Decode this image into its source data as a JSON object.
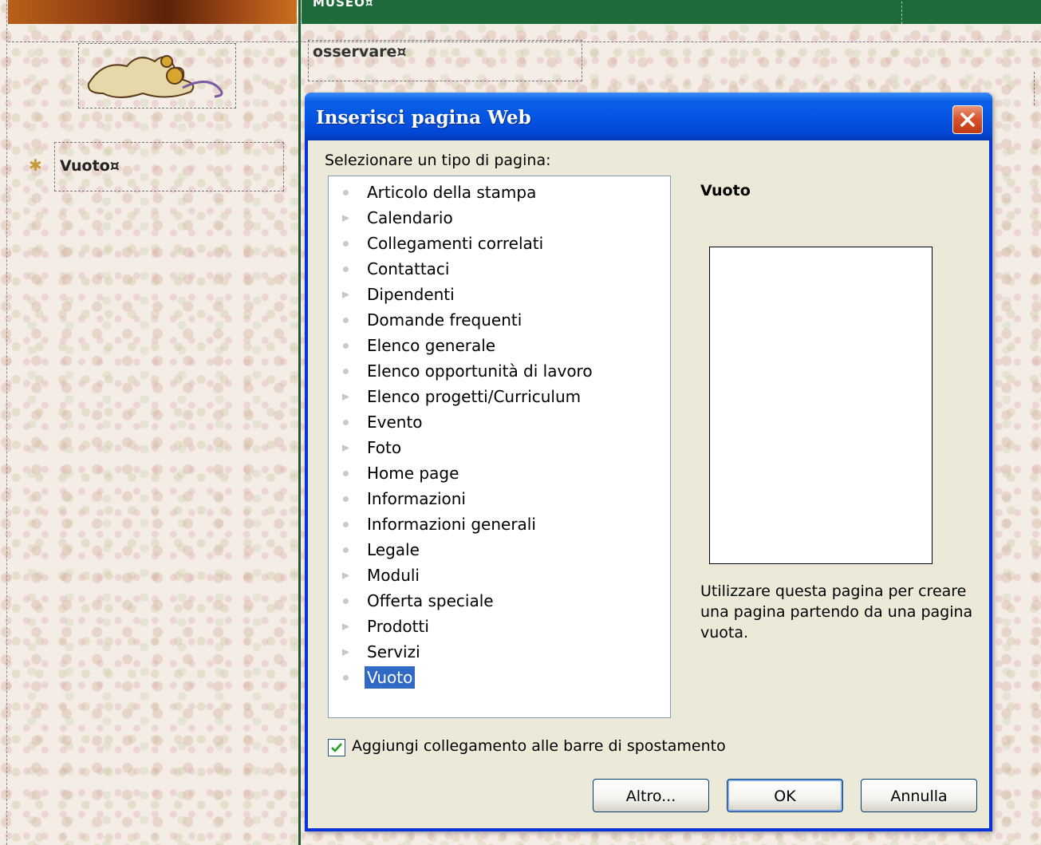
{
  "background": {
    "nav_label": "MUSEO¤",
    "sidebar_item": "Vuoto¤",
    "content_text": "osservare¤"
  },
  "dialog": {
    "title": "Inserisci pagina Web",
    "prompt": "Selezionare un tipo di pagina:",
    "items": [
      {
        "label": "Articolo della stampa",
        "icon": "dot"
      },
      {
        "label": "Calendario",
        "icon": "arrow"
      },
      {
        "label": "Collegamenti correlati",
        "icon": "dot"
      },
      {
        "label": "Contattaci",
        "icon": "dot"
      },
      {
        "label": "Dipendenti",
        "icon": "arrow"
      },
      {
        "label": "Domande frequenti",
        "icon": "dot"
      },
      {
        "label": "Elenco generale",
        "icon": "dot"
      },
      {
        "label": "Elenco opportunità di lavoro",
        "icon": "dot"
      },
      {
        "label": "Elenco progetti/Curriculum",
        "icon": "arrow"
      },
      {
        "label": "Evento",
        "icon": "dot"
      },
      {
        "label": "Foto",
        "icon": "arrow"
      },
      {
        "label": "Home page",
        "icon": "dot"
      },
      {
        "label": "Informazioni",
        "icon": "dot"
      },
      {
        "label": "Informazioni generali",
        "icon": "dot"
      },
      {
        "label": "Legale",
        "icon": "dot"
      },
      {
        "label": "Moduli",
        "icon": "arrow"
      },
      {
        "label": "Offerta speciale",
        "icon": "dot"
      },
      {
        "label": "Prodotti",
        "icon": "arrow"
      },
      {
        "label": "Servizi",
        "icon": "arrow"
      },
      {
        "label": "Vuoto",
        "icon": "dot",
        "selected": true
      }
    ],
    "preview_title": "Vuoto",
    "preview_description": "Utilizzare questa pagina per creare una pagina partendo da una pagina vuota.",
    "checkbox_label": "Aggiungi collegamento alle barre di spostamento",
    "checkbox_checked": true,
    "buttons": {
      "altro": "Altro...",
      "ok": "OK",
      "annulla": "Annulla"
    }
  },
  "colors": {
    "titlebar": "#0456e3",
    "selection": "#316ac5",
    "nav_green": "#1f6a3a"
  }
}
